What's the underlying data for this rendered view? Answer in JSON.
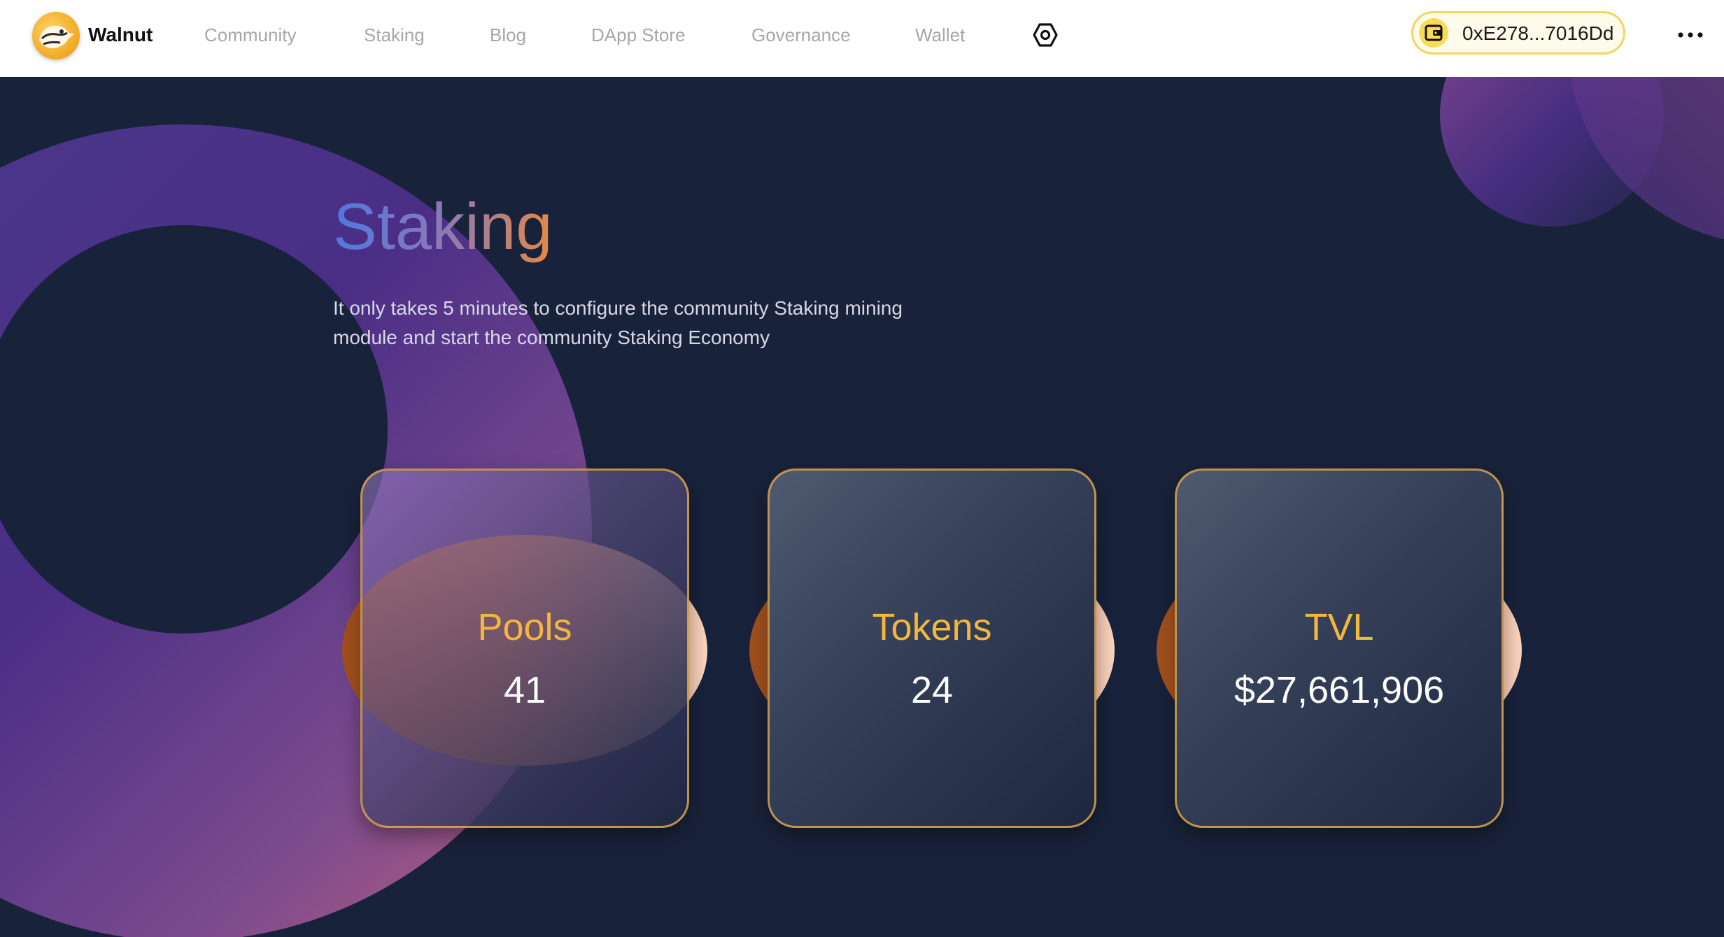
{
  "brand": {
    "name": "Walnut",
    "logo_icon": "walnut-mascot-logo"
  },
  "nav": {
    "items": [
      {
        "label": "Community"
      },
      {
        "label": "Staking"
      },
      {
        "label": "Blog"
      },
      {
        "label": "DApp Store"
      },
      {
        "label": "Governance"
      },
      {
        "label": "Wallet"
      }
    ],
    "settings_icon": "hexagon-gear-icon",
    "more_icon": "more-horizontal-icon"
  },
  "wallet": {
    "address": "0xE278...7016Dd",
    "icon": "wallet-icon"
  },
  "hero": {
    "title": "Staking",
    "description": "It only takes 5 minutes to configure the community Staking mining module and start the community Staking Economy"
  },
  "stats": [
    {
      "label": "Pools",
      "value": "41"
    },
    {
      "label": "Tokens",
      "value": "24"
    },
    {
      "label": "TVL",
      "value": "$27,661,906"
    }
  ],
  "colors": {
    "background": "#19223b",
    "navbar": "#ffffff",
    "nav_text": "#a7a7a7",
    "accent_gold": "#f5b63c",
    "wallet_border": "#f3d560",
    "ring_purple": "#4a2e86",
    "ring_pink": "#c2607c"
  }
}
